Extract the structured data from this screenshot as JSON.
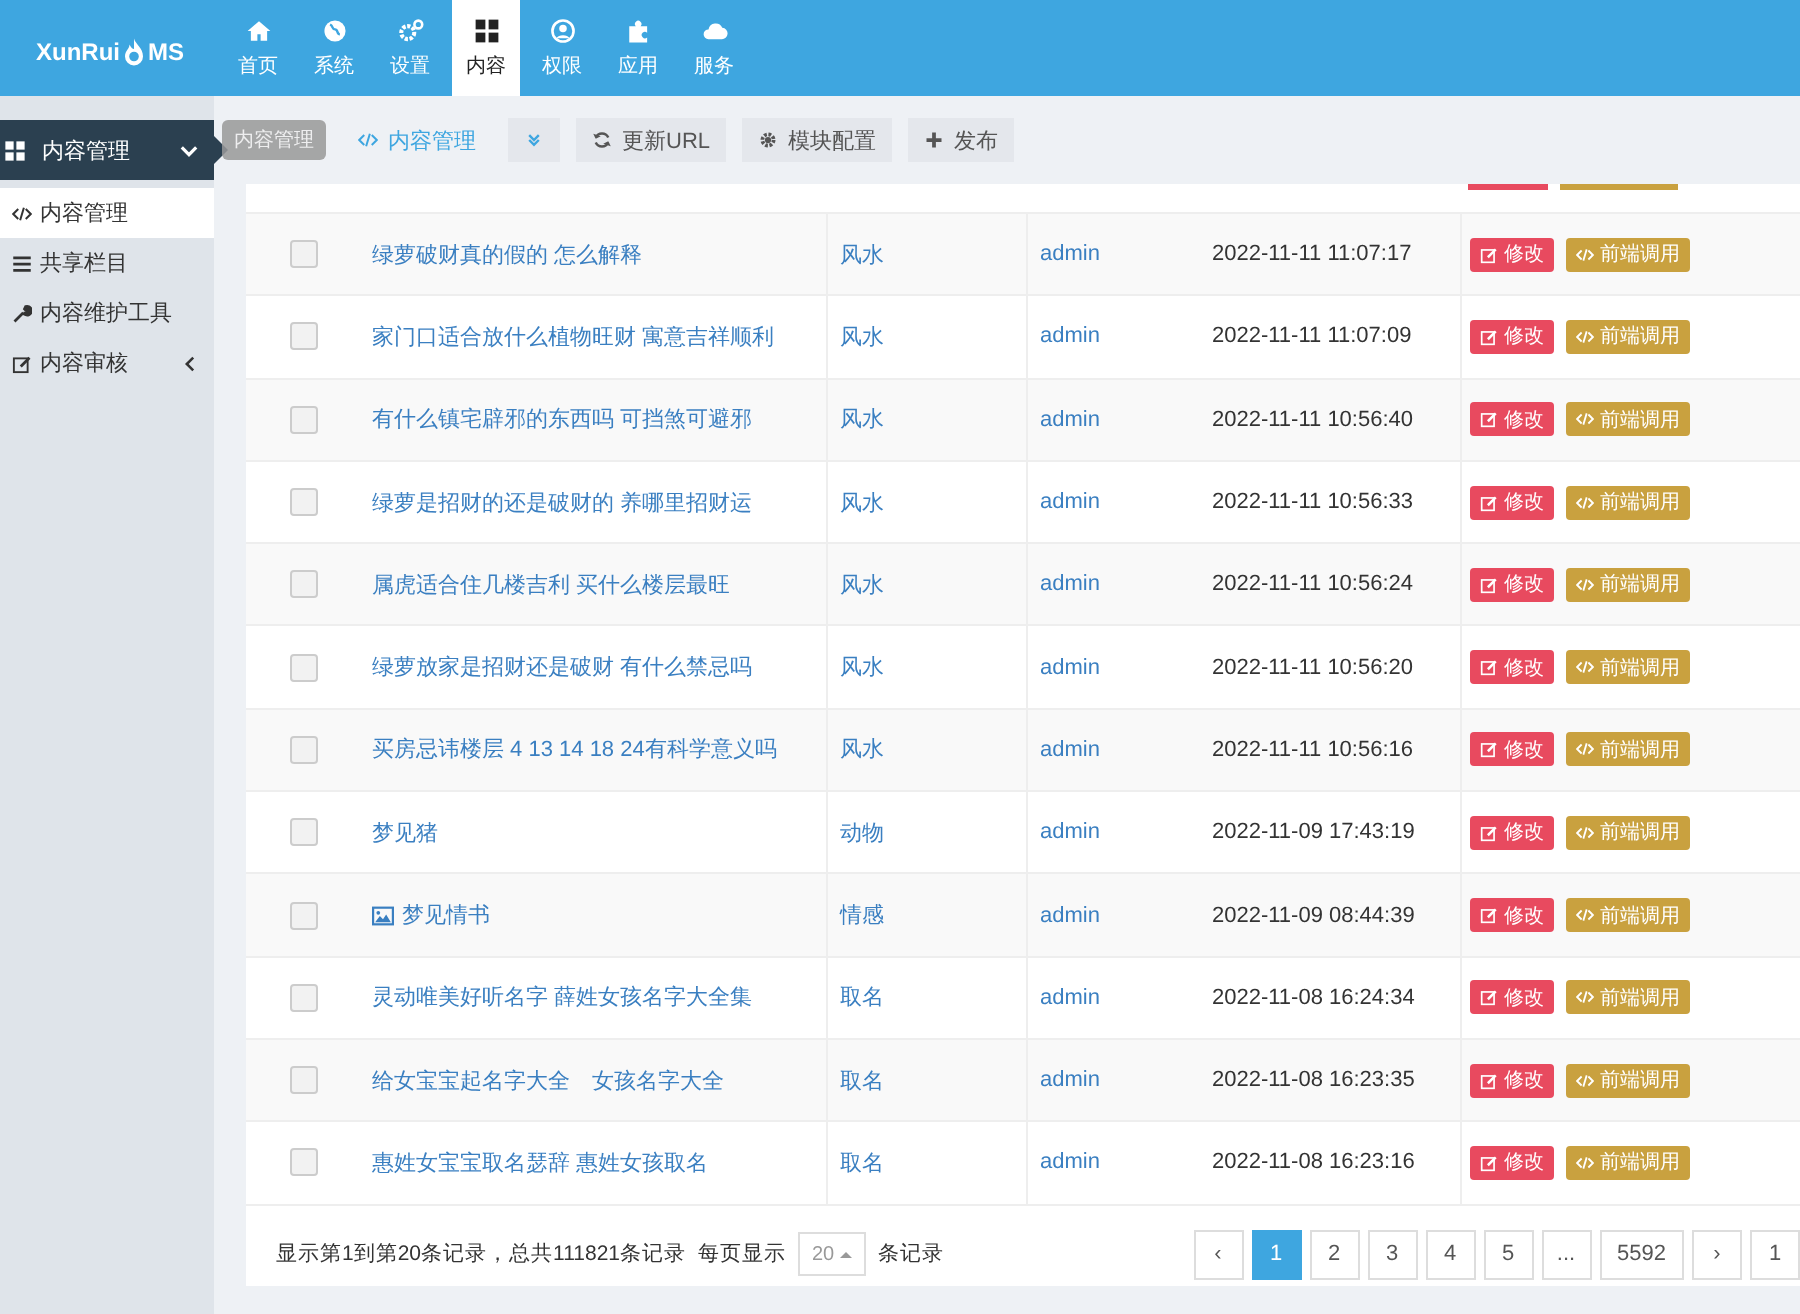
{
  "logo": {
    "text_before": "XunRui",
    "text_after": "MS"
  },
  "nav": [
    {
      "label": "首页",
      "selected": false
    },
    {
      "label": "系统",
      "selected": false
    },
    {
      "label": "设置",
      "selected": false
    },
    {
      "label": "内容",
      "selected": true
    },
    {
      "label": "权限",
      "selected": false
    },
    {
      "label": "应用",
      "selected": false
    },
    {
      "label": "服务",
      "selected": false
    }
  ],
  "sidebar": {
    "header": "内容管理",
    "tooltip": "内容管理",
    "items": [
      {
        "label": "内容管理",
        "selected": true,
        "has_submenu": false
      },
      {
        "label": "共享栏目",
        "selected": false,
        "has_submenu": false
      },
      {
        "label": "内容维护工具",
        "selected": false,
        "has_submenu": false
      },
      {
        "label": "内容审核",
        "selected": false,
        "has_submenu": true
      }
    ]
  },
  "toolbar": {
    "title": "内容管理",
    "buttons": [
      {
        "label": "更新URL"
      },
      {
        "label": "模块配置"
      },
      {
        "label": "发布"
      }
    ]
  },
  "rows": [
    {
      "title": "绿萝破财真的假的 怎么解释",
      "category": "风水",
      "author": "admin",
      "date": "2022-11-11 11:07:17",
      "has_image": false,
      "checked": false,
      "edit": "修改",
      "call": "前端调用"
    },
    {
      "title": "家门口适合放什么植物旺财 寓意吉祥顺利",
      "category": "风水",
      "author": "admin",
      "date": "2022-11-11 11:07:09",
      "has_image": false,
      "checked": false,
      "edit": "修改",
      "call": "前端调用"
    },
    {
      "title": "有什么镇宅辟邪的东西吗 可挡煞可避邪",
      "category": "风水",
      "author": "admin",
      "date": "2022-11-11 10:56:40",
      "has_image": false,
      "checked": false,
      "edit": "修改",
      "call": "前端调用"
    },
    {
      "title": "绿萝是招财的还是破财的 养哪里招财运",
      "category": "风水",
      "author": "admin",
      "date": "2022-11-11 10:56:33",
      "has_image": false,
      "checked": false,
      "edit": "修改",
      "call": "前端调用"
    },
    {
      "title": "属虎适合住几楼吉利 买什么楼层最旺",
      "category": "风水",
      "author": "admin",
      "date": "2022-11-11 10:56:24",
      "has_image": false,
      "checked": false,
      "edit": "修改",
      "call": "前端调用"
    },
    {
      "title": "绿萝放家是招财还是破财 有什么禁忌吗",
      "category": "风水",
      "author": "admin",
      "date": "2022-11-11 10:56:20",
      "has_image": false,
      "checked": false,
      "edit": "修改",
      "call": "前端调用"
    },
    {
      "title": "买房忌讳楼层 4 13 14 18 24有科学意义吗",
      "category": "风水",
      "author": "admin",
      "date": "2022-11-11 10:56:16",
      "has_image": false,
      "checked": false,
      "edit": "修改",
      "call": "前端调用"
    },
    {
      "title": "梦见猪",
      "category": "动物",
      "author": "admin",
      "date": "2022-11-09 17:43:19",
      "has_image": false,
      "checked": false,
      "edit": "修改",
      "call": "前端调用"
    },
    {
      "title": "梦见情书",
      "category": "情感",
      "author": "admin",
      "date": "2022-11-09 08:44:39",
      "has_image": true,
      "checked": false,
      "edit": "修改",
      "call": "前端调用"
    },
    {
      "title": "灵动唯美好听名字 薛姓女孩名字大全集",
      "category": "取名",
      "author": "admin",
      "date": "2022-11-08 16:24:34",
      "has_image": false,
      "checked": false,
      "edit": "修改",
      "call": "前端调用"
    },
    {
      "title": "给女宝宝起名字大全　女孩名字大全",
      "category": "取名",
      "author": "admin",
      "date": "2022-11-08 16:23:35",
      "has_image": false,
      "checked": false,
      "edit": "修改",
      "call": "前端调用"
    },
    {
      "title": "惠姓女宝宝取名瑟辞 惠姓女孩取名",
      "category": "取名",
      "author": "admin",
      "date": "2022-11-08 16:23:16",
      "has_image": false,
      "checked": false,
      "edit": "修改",
      "call": "前端调用"
    }
  ],
  "footer": {
    "summary": "显示第1到第20条记录，总共111821条记录",
    "per_page_label": "每页显示",
    "per_page": "20",
    "per_page_suffix": "条记录"
  },
  "pagination": [
    {
      "label": "‹",
      "selected": false
    },
    {
      "label": "1",
      "selected": true
    },
    {
      "label": "2",
      "selected": false
    },
    {
      "label": "3",
      "selected": false
    },
    {
      "label": "4",
      "selected": false
    },
    {
      "label": "5",
      "selected": false
    },
    {
      "label": "...",
      "selected": false
    },
    {
      "label": "5592",
      "selected": false
    },
    {
      "label": "›",
      "selected": false
    },
    {
      "label": "1",
      "selected": false
    }
  ]
}
